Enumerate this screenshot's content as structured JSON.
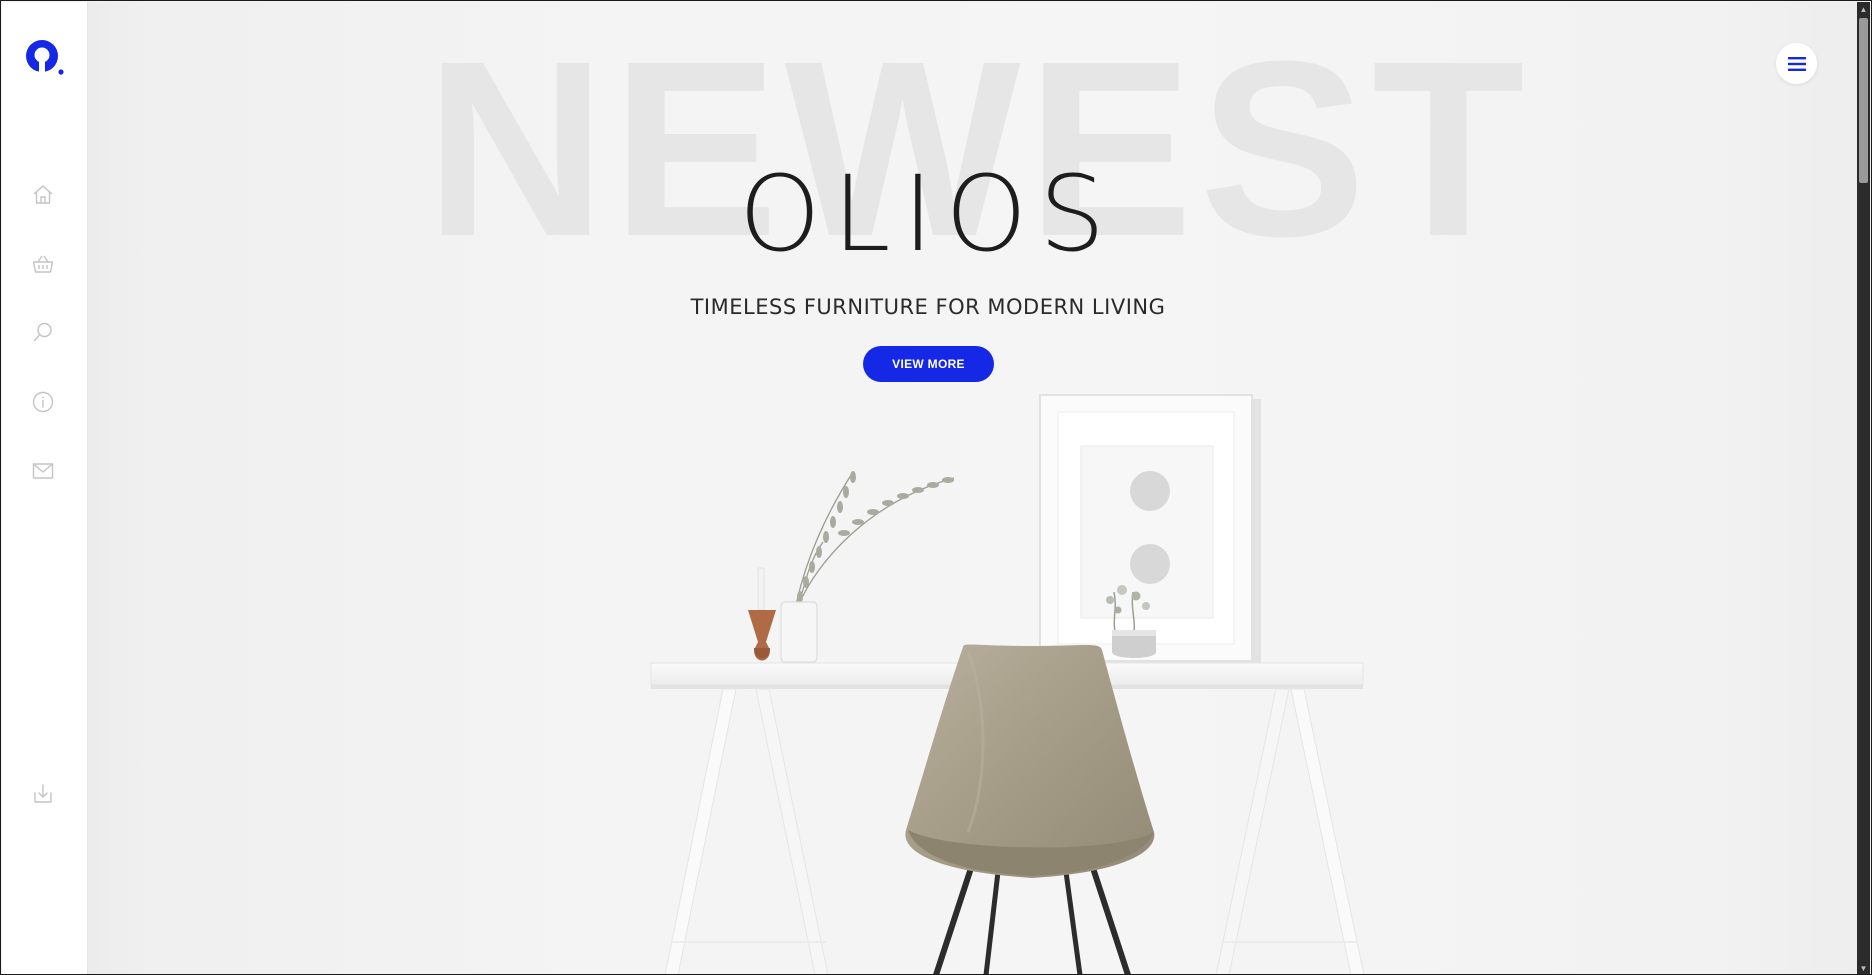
{
  "sidebar": {
    "logo": "olios-logo",
    "items": [
      {
        "name": "home",
        "icon": "home-icon"
      },
      {
        "name": "shop",
        "icon": "basket-icon"
      },
      {
        "name": "search",
        "icon": "search-icon"
      },
      {
        "name": "info",
        "icon": "info-icon"
      },
      {
        "name": "contact",
        "icon": "mail-icon"
      }
    ],
    "bottom_icon": "download-icon"
  },
  "hero": {
    "background_word": "NEWEST",
    "brand": "OLIOS",
    "tagline": "TIMELESS FURNITURE FOR MODERN LIVING",
    "cta_label": "VIEW MORE"
  },
  "header": {
    "menu_icon": "hamburger-menu-icon"
  },
  "colors": {
    "accent": "#1428e6",
    "sidebar_bg": "#ffffff",
    "hero_bg": "#f3f3f3",
    "icon_grey": "#c4c4c4"
  }
}
